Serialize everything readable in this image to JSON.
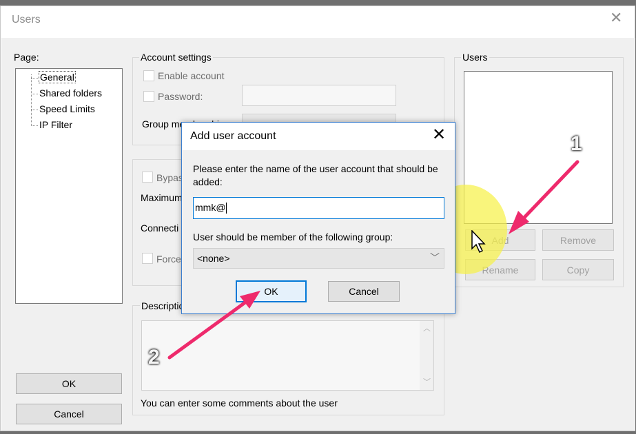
{
  "window": {
    "title": "Users",
    "close_glyph": "✕"
  },
  "page_panel": {
    "label": "Page:",
    "tree": [
      "General",
      "Shared folders",
      "Speed Limits",
      "IP Filter"
    ]
  },
  "left_buttons": {
    "ok": "OK",
    "cancel": "Cancel"
  },
  "account_settings": {
    "group_label": "Account settings",
    "enable_account": "Enable account",
    "password": "Password:",
    "group_membership": "Group membership:"
  },
  "partial_fields": {
    "bypass": "Bypas",
    "maximum": "Maximum",
    "connections": "Connecti",
    "force": "Force"
  },
  "description": {
    "label": "Descriptio",
    "hint": "You can enter some comments about the user"
  },
  "users_panel": {
    "label": "Users",
    "add": "Add",
    "remove": "Remove",
    "rename": "Rename",
    "copy": "Copy"
  },
  "dialog": {
    "title": "Add user account",
    "prompt": "Please enter the name of the user account that should be added:",
    "input_value": "mmk@",
    "group_prompt": "User should be member of the following group:",
    "group_selected": "<none>",
    "ok": "OK",
    "cancel": "Cancel",
    "close_glyph": "✕"
  },
  "annotations": {
    "step1": "1",
    "step2": "2",
    "arrow_color": "#ee2a6c",
    "highlight_color": "#f6f14a"
  }
}
